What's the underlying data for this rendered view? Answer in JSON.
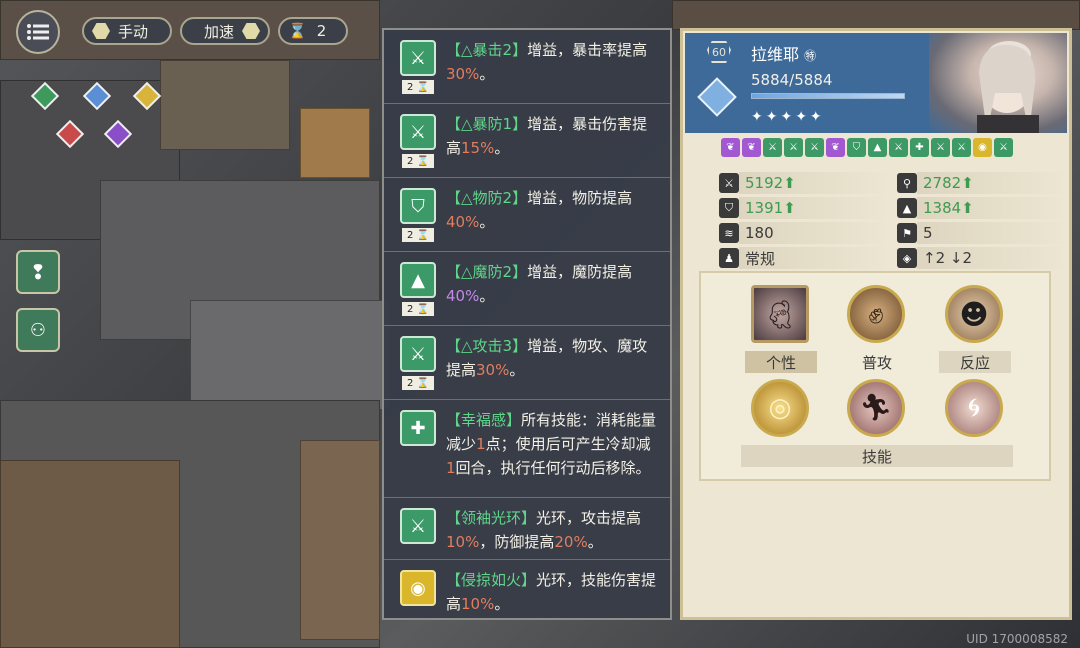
{
  "hud": {
    "menu_icon": "menu-icon",
    "mode_label": "手动",
    "speed_label": "加速",
    "turn_count": "2"
  },
  "buffs": [
    {
      "icon": "crit-up-icon",
      "name": "【△暴击2】",
      "pre": "增益，暴击率提高",
      "val": "30%",
      "post": "。",
      "turns": "2"
    },
    {
      "icon": "crit-def-up-icon",
      "name": "【△暴防1】",
      "pre": "增益，暴击伤害提高",
      "val": "15%",
      "post": "。",
      "turns": "2"
    },
    {
      "icon": "shield-up-icon",
      "name": "【△物防2】",
      "pre": "增益，物防提高",
      "val": "40%",
      "post": "。",
      "turns": "2"
    },
    {
      "icon": "witch-hat-up-icon",
      "name": "【△魔防2】",
      "pre": "增益，魔防提高",
      "val": "40%",
      "post": "。",
      "turns": "2"
    },
    {
      "icon": "sword-up-icon",
      "name": "【△攻击3】",
      "pre": "增益，物攻、魔攻提高",
      "val": "30%",
      "post": "。",
      "turns": "2"
    },
    {
      "icon": "cross-icon",
      "name": "【幸福感】",
      "t1": "所有技能：消耗能量减少",
      "v1": "1",
      "t2": "点；使用后可产生冷却减",
      "v2": "1",
      "t3": "回合，执行任何行动后移除。"
    },
    {
      "icon": "sword-up-icon",
      "name": "【领袖光环】",
      "t1": "光环，攻击提高",
      "v1": "10%",
      "t2": "，防御提高",
      "v2": "20%",
      "t3": "。"
    },
    {
      "icon": "fire-aura-icon",
      "name": "【侵掠如火】",
      "pre": "光环，技能伤害提高",
      "val": "10%",
      "post": "。"
    }
  ],
  "character": {
    "level": "60",
    "name": "拉维耶",
    "hp": "5884/5884",
    "hp_fraction": 1.0,
    "stars": "✦✦✦✦✦",
    "element_icon": "ice-element-icon"
  },
  "stats": {
    "phys_atk": "5192",
    "mag_atk": "2782",
    "phys_def": "1391",
    "mag_def": "1384",
    "speed": "180",
    "move": "5",
    "class": "常规",
    "jump": "↑2 ↓2"
  },
  "skills": {
    "trait_label": "个性",
    "normal_label": "普攻",
    "reaction_label": "反应",
    "skills_label": "技能"
  },
  "uid": "UID 1700008582",
  "colors": {
    "buff_green": "#5fd68a",
    "value_red": "#e27d5e",
    "value_purple": "#c289e8",
    "stat_green": "#3f9a52",
    "panel_blue": "#3d6a98"
  }
}
